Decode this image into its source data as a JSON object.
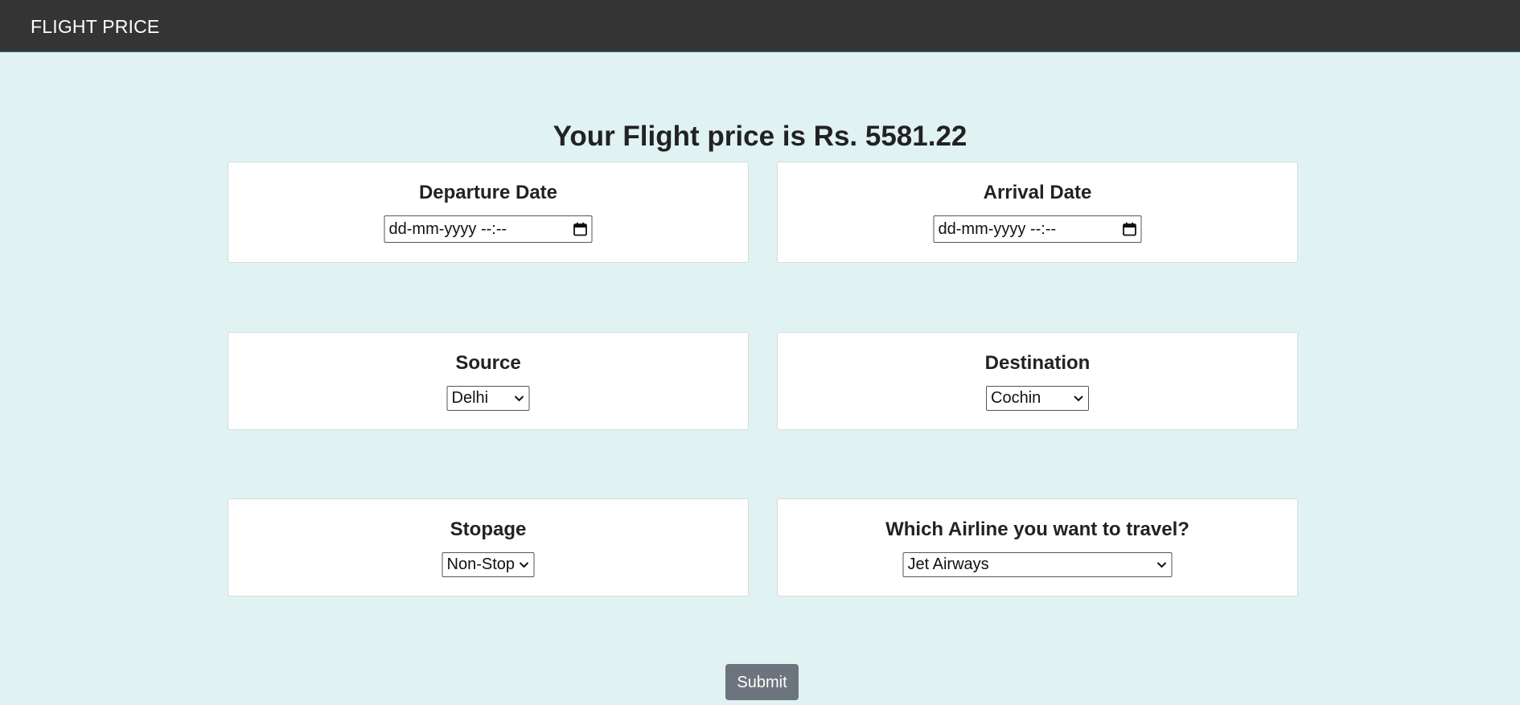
{
  "navbar": {
    "brand": "FLIGHT PRICE"
  },
  "result": {
    "text": "Your Flight price is Rs. 5581.22"
  },
  "departure": {
    "label": "Departure Date",
    "value": "dd-mm-yyyy --:--",
    "icon": "calendar-icon"
  },
  "arrival": {
    "label": "Arrival Date",
    "value": "dd-mm-yyyy --:--",
    "icon": "calendar-icon"
  },
  "source": {
    "label": "Source",
    "selected": "Delhi"
  },
  "destination": {
    "label": "Destination",
    "selected": "Cochin"
  },
  "stopage": {
    "label": "Stopage",
    "selected": "Non-Stop"
  },
  "airline": {
    "label": "Which Airline you want to travel?",
    "selected": "Jet Airways"
  },
  "submit": {
    "label": "Submit"
  },
  "colors": {
    "navbar": "#343434",
    "background": "#e0f2f1",
    "button": "#6c757d"
  }
}
